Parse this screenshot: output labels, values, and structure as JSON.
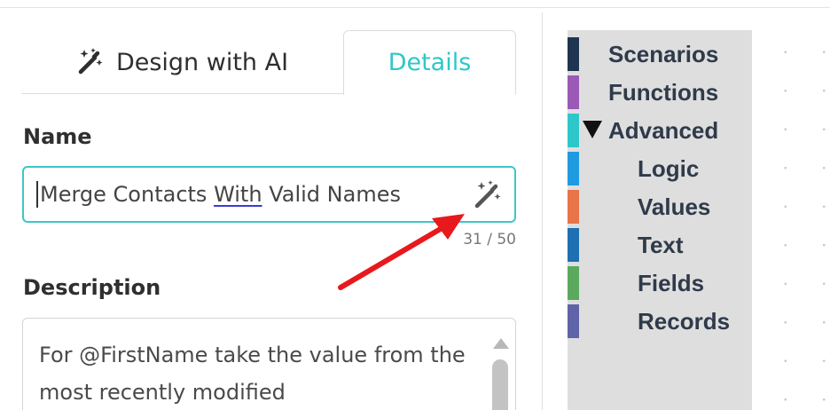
{
  "tabs": {
    "design_ai_label": "Design with AI",
    "details_label": "Details",
    "active": "Details"
  },
  "form": {
    "name_label": "Name",
    "name_value_before": "Merge Contacts ",
    "name_value_underlined": "With",
    "name_value_after": " Valid Names",
    "char_counter": "31 / 50",
    "description_label": "Description",
    "description_value": "For @FirstName take the value from the most recently modified"
  },
  "categories": [
    {
      "label": "Scenarios",
      "color": "#1f3450",
      "level": 0
    },
    {
      "label": "Functions",
      "color": "#9b59b6",
      "level": 0
    },
    {
      "label": "Advanced",
      "color": "#2ec7c9",
      "level": 0,
      "expanded": true
    },
    {
      "label": "Logic",
      "color": "#1e9be0",
      "level": 1
    },
    {
      "label": "Values",
      "color": "#e8744a",
      "level": 1
    },
    {
      "label": "Text",
      "color": "#1f6fb3",
      "level": 1
    },
    {
      "label": "Fields",
      "color": "#5aa95e",
      "level": 1
    },
    {
      "label": "Records",
      "color": "#5f64a8",
      "level": 1
    }
  ],
  "colors": {
    "accent": "#2ec7c9",
    "input_border": "#3fc6c5",
    "annotation_arrow": "#e8191c"
  },
  "icons": {
    "tab_icon": "magic-wand-icon",
    "field_icon": "magic-wand-icon"
  }
}
